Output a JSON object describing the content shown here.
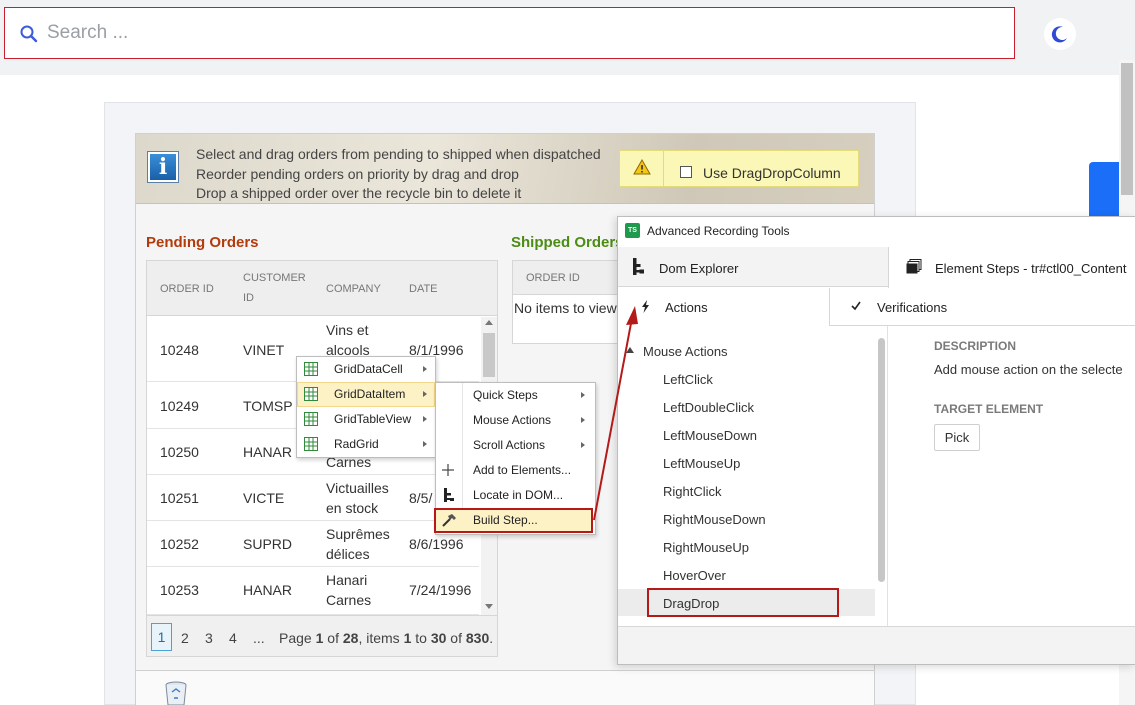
{
  "search": {
    "placeholder": "Search ..."
  },
  "info": {
    "lines": [
      "Select and drag orders from pending to shipped when dispatched",
      "Reorder pending orders on priority by drag and drop",
      "Drop a shipped order over the recycle bin to delete it"
    ],
    "checkbox_label": "Use DragDropColumn"
  },
  "pending": {
    "title": "Pending Orders",
    "columns": [
      "ORDER ID",
      "CUSTOMER ID",
      "COMPANY",
      "DATE"
    ],
    "rows": [
      {
        "order_id": "10248",
        "customer_id": "VINET",
        "company": "Vins et alcools",
        "date": "8/1/1996"
      },
      {
        "order_id": "10249",
        "customer_id": "TOMSP",
        "company": "",
        "date": ""
      },
      {
        "order_id": "10250",
        "customer_id": "HANAR",
        "company": "Carnes",
        "date": ""
      },
      {
        "order_id": "10251",
        "customer_id": "VICTE",
        "company": "Victuailles en stock",
        "date": "8/5/"
      },
      {
        "order_id": "10252",
        "customer_id": "SUPRD",
        "company": "Suprêmes délices",
        "date": "8/6/1996"
      },
      {
        "order_id": "10253",
        "customer_id": "HANAR",
        "company": "Hanari Carnes",
        "date": "7/24/1996"
      }
    ],
    "pager": {
      "pages": [
        "1",
        "2",
        "3",
        "4",
        "..."
      ],
      "info_prefix": "Page ",
      "current": "1",
      "of": " of ",
      "total_pages": "28",
      "items_text": ", items ",
      "from": "1",
      "to_text": " to ",
      "to": "30",
      "total_items": "830",
      "suffix": "."
    }
  },
  "shipped": {
    "title": "Shipped Orders",
    "column": "ORDER ID",
    "empty": "No items to view"
  },
  "context_menu": {
    "primary": [
      "GridDataCell",
      "GridDataItem",
      "GridTableView",
      "RadGrid"
    ],
    "secondary": [
      "Quick Steps",
      "Mouse Actions",
      "Scroll Actions",
      "Add to Elements...",
      "Locate in DOM...",
      "Build Step..."
    ]
  },
  "recording_tools": {
    "title": "Advanced Recording Tools",
    "logo": "TS",
    "tabs": {
      "dom": "Dom Explorer",
      "steps": "Element Steps - tr#ctl00_Content"
    },
    "subtabs": {
      "actions": "Actions",
      "verifications": "Verifications"
    },
    "group": "Mouse Actions",
    "items": [
      "LeftClick",
      "LeftDoubleClick",
      "LeftMouseDown",
      "LeftMouseUp",
      "RightClick",
      "RightMouseDown",
      "RightMouseUp",
      "HoverOver",
      "DragDrop"
    ],
    "description_label": "DESCRIPTION",
    "description_text": "Add mouse action on the selecte",
    "target_label": "TARGET ELEMENT",
    "pick_label": "Pick"
  },
  "colors": {
    "highlight_red": "#b41a1a",
    "pending_title": "#b23b0d",
    "shipped_title": "#4c8c14",
    "accent_blue": "#1a6ef7"
  }
}
